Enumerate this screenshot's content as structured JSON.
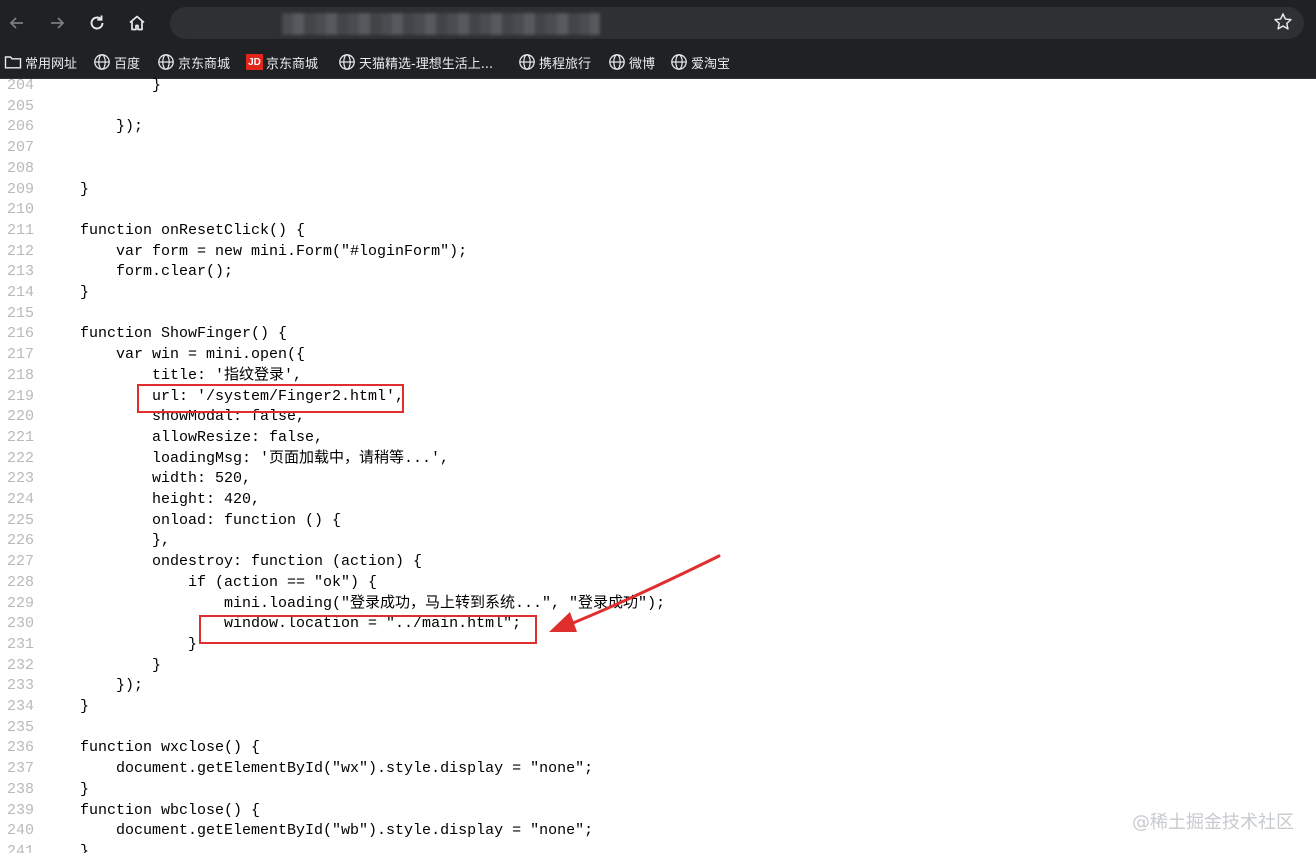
{
  "browser": {
    "back_icon": "arrow-left-icon",
    "forward_icon": "arrow-right-icon",
    "reload_icon": "reload-icon",
    "home_icon": "home-icon",
    "star_icon": "star-icon"
  },
  "bookmarks": [
    {
      "label": "常用网址",
      "icon": "folder-icon"
    },
    {
      "label": "百度",
      "icon": "globe-icon"
    },
    {
      "label": "京东商城",
      "icon": "globe-icon"
    },
    {
      "label": "京东商城",
      "icon": "jd-logo-icon",
      "logo_text": "JD"
    },
    {
      "label": "天猫精选-理想生活上...",
      "icon": "globe-icon"
    },
    {
      "label": "携程旅行",
      "icon": "globe-icon"
    },
    {
      "label": "微博",
      "icon": "globe-icon"
    },
    {
      "label": "爱淘宝",
      "icon": "globe-icon"
    }
  ],
  "code_lines": [
    {
      "num": "204",
      "text": "            }"
    },
    {
      "num": "205",
      "text": ""
    },
    {
      "num": "206",
      "text": "        });"
    },
    {
      "num": "207",
      "text": ""
    },
    {
      "num": "208",
      "text": ""
    },
    {
      "num": "209",
      "text": "    }"
    },
    {
      "num": "210",
      "text": ""
    },
    {
      "num": "211",
      "text": "    function onResetClick() {"
    },
    {
      "num": "212",
      "text": "        var form = new mini.Form(\"#loginForm\");"
    },
    {
      "num": "213",
      "text": "        form.clear();"
    },
    {
      "num": "214",
      "text": "    }"
    },
    {
      "num": "215",
      "text": ""
    },
    {
      "num": "216",
      "text": "    function ShowFinger() {"
    },
    {
      "num": "217",
      "text": "        var win = mini.open({"
    },
    {
      "num": "218",
      "text": "            title: '指纹登录',"
    },
    {
      "num": "219",
      "text": "            url: '/system/Finger2.html',"
    },
    {
      "num": "220",
      "text": "            showModal: false,"
    },
    {
      "num": "221",
      "text": "            allowResize: false,"
    },
    {
      "num": "222",
      "text": "            loadingMsg: '页面加载中，请稍等...',"
    },
    {
      "num": "223",
      "text": "            width: 520,"
    },
    {
      "num": "224",
      "text": "            height: 420,"
    },
    {
      "num": "225",
      "text": "            onload: function () {"
    },
    {
      "num": "226",
      "text": "            },"
    },
    {
      "num": "227",
      "text": "            ondestroy: function (action) {"
    },
    {
      "num": "228",
      "text": "                if (action == \"ok\") {"
    },
    {
      "num": "229",
      "text": "                    mini.loading(\"登录成功，马上转到系统...\", \"登录成功\");"
    },
    {
      "num": "230",
      "text": "                    window.location = \"../main.html\";"
    },
    {
      "num": "231",
      "text": "                }"
    },
    {
      "num": "232",
      "text": "            }"
    },
    {
      "num": "233",
      "text": "        });"
    },
    {
      "num": "234",
      "text": "    }"
    },
    {
      "num": "235",
      "text": ""
    },
    {
      "num": "236",
      "text": "    function wxclose() {"
    },
    {
      "num": "237",
      "text": "        document.getElementById(\"wx\").style.display = \"none\";"
    },
    {
      "num": "238",
      "text": "    }"
    },
    {
      "num": "239",
      "text": "    function wbclose() {"
    },
    {
      "num": "240",
      "text": "        document.getElementById(\"wb\").style.display = \"none\";"
    },
    {
      "num": "241",
      "text": "    }"
    }
  ],
  "annotation_color": "#e02e2e",
  "watermark": "@稀土掘金技术社区"
}
